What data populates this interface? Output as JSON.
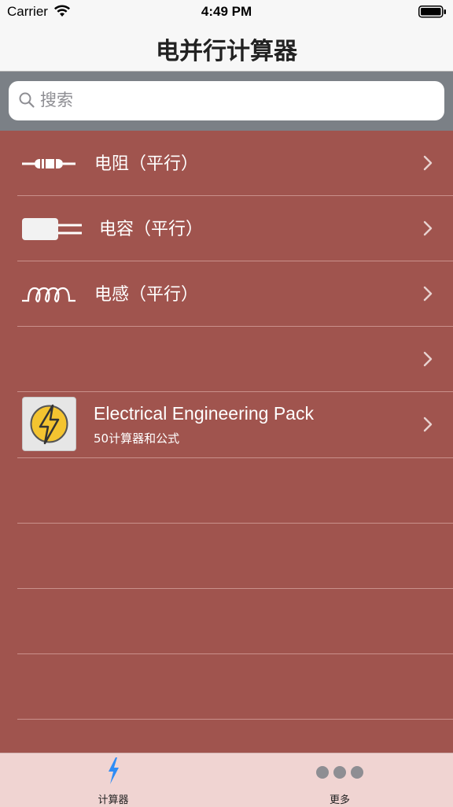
{
  "status_bar": {
    "carrier": "Carrier",
    "time": "4:49 PM"
  },
  "nav": {
    "title": "电并行计算器"
  },
  "search": {
    "placeholder": "搜索"
  },
  "list": {
    "items": [
      {
        "label": "电阻（平行）",
        "icon": "resistor-icon"
      },
      {
        "label": "电容（平行）",
        "icon": "capacitor-icon"
      },
      {
        "label": "电感（平行）",
        "icon": "inductor-icon"
      },
      {
        "label": "",
        "icon": ""
      },
      {
        "label": "Electrical Engineering Pack",
        "subtitle": "50计算器和公式",
        "icon": "lightning-bolt-icon"
      }
    ]
  },
  "tab_bar": {
    "tabs": [
      {
        "label": "计算器",
        "icon": "lightning-icon",
        "selected": true
      },
      {
        "label": "更多",
        "icon": "more-dots-icon",
        "selected": false
      }
    ]
  },
  "colors": {
    "list_background": "#a0544e",
    "tab_bar_background": "#f0d4d2",
    "search_bar_background": "#7b8086",
    "accent": "#2f8cf5"
  }
}
